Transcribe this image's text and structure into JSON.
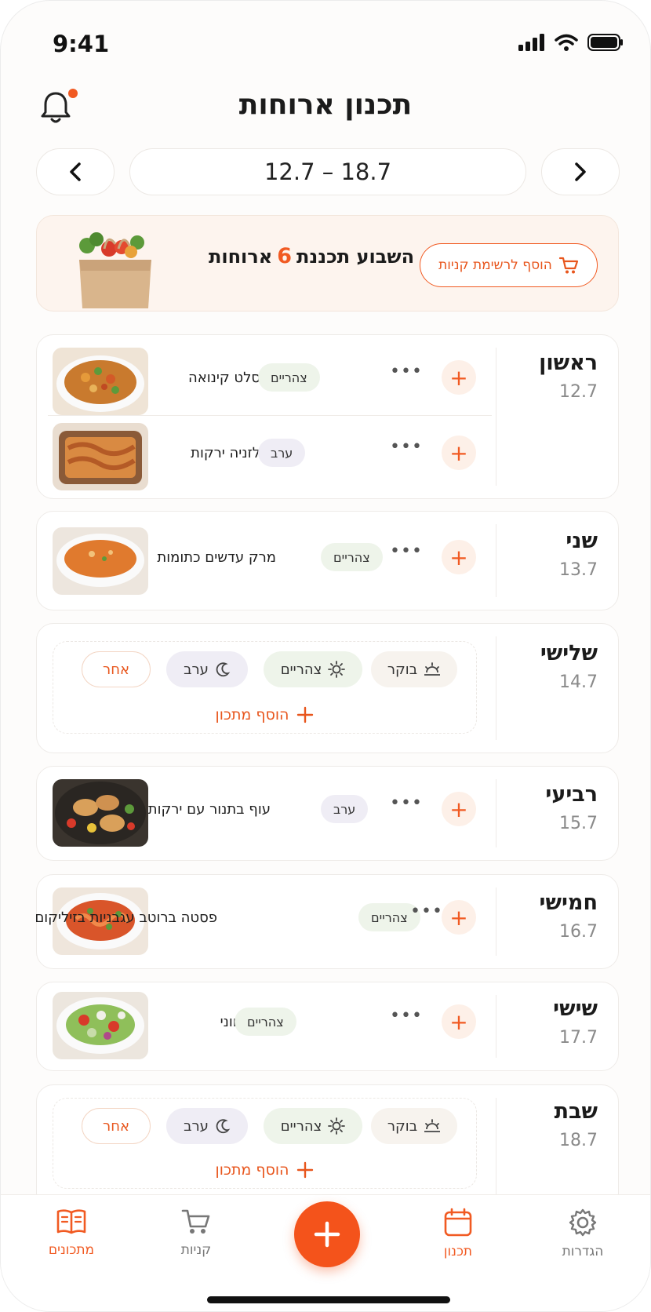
{
  "status_bar": {
    "time": "9:41"
  },
  "header": {
    "title": "תכנון ארוחות"
  },
  "week_nav": {
    "range": "12.7 – 18.7"
  },
  "summary": {
    "text_before": "השבוע תכננת",
    "count": "6",
    "text_after": "ארוחות",
    "add_to_list_label": "הוסף לרשימת קניות"
  },
  "days": [
    {
      "name": "ראשון",
      "date": "12.7",
      "meals": [
        {
          "name": "סלט קינואה",
          "tag": "צהריים"
        },
        {
          "name": "לזניה ירקות",
          "tag": "ערב"
        }
      ]
    },
    {
      "name": "שני",
      "date": "13.7",
      "meals": [
        {
          "name": "מרק עדשים כתומות",
          "tag": "צהריים"
        }
      ]
    },
    {
      "name": "שלישי",
      "date": "14.7",
      "empty": {
        "morning": "בוקר",
        "lunch": "צהריים",
        "dinner": "ערב",
        "other": "אחר",
        "add_label": "הוסף מתכון"
      }
    },
    {
      "name": "רביעי",
      "date": "15.7",
      "meals": [
        {
          "name": "עוף בתנור עם ירקות",
          "tag": "ערב"
        }
      ]
    },
    {
      "name": "חמישי",
      "date": "16.7",
      "meals": [
        {
          "name": "פסטה ברוטב עגבניות בזיליקום",
          "tag": "צהריים"
        }
      ]
    },
    {
      "name": "שישי",
      "date": "17.7",
      "meals": [
        {
          "name": "סלט יווני",
          "tag": "צהריים"
        }
      ]
    },
    {
      "name": "שבת",
      "date": "18.7",
      "empty": {
        "morning": "בוקר",
        "lunch": "צהריים",
        "dinner": "ערב",
        "other": "אחר",
        "add_label": "הוסף מתכון"
      }
    }
  ],
  "bottom_nav": {
    "recipes": "מתכונים",
    "shopping": "קניות",
    "planner": "תכנון",
    "settings": "הגדרות"
  },
  "colors": {
    "accent": "#f15a22",
    "background": "#fdfcfb"
  },
  "icons": [
    "bell-icon",
    "chevron-left-icon",
    "chevron-right-icon",
    "cart-icon",
    "sunrise-icon",
    "sun-icon",
    "moon-icon",
    "plus-icon",
    "book-icon",
    "calendar-icon",
    "gear-icon"
  ]
}
